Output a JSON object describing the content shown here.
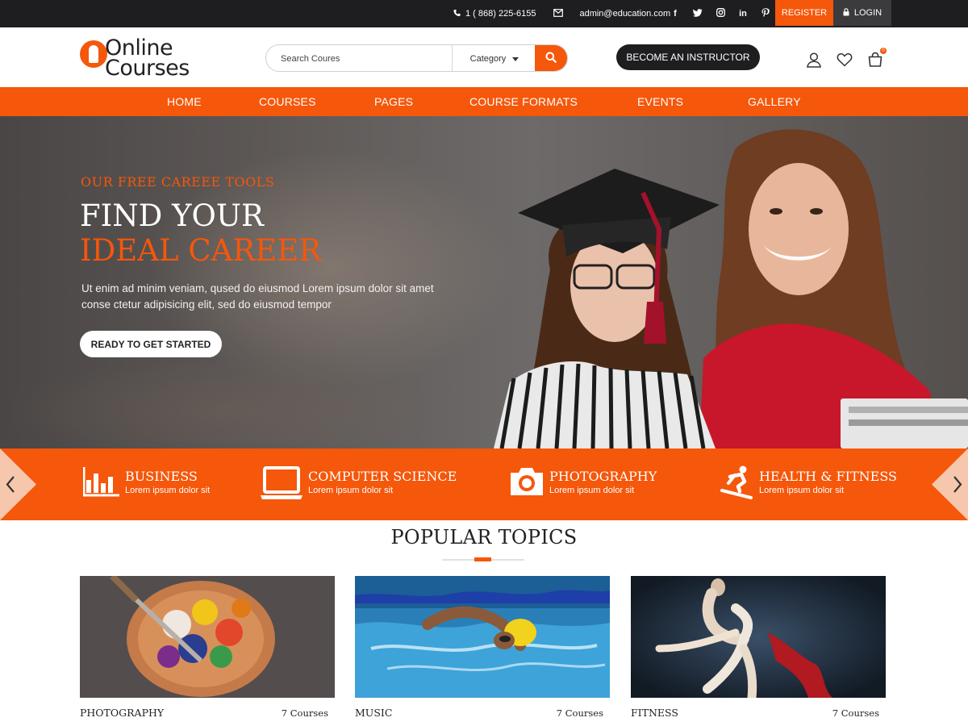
{
  "topbar": {
    "phone": "1 ( 868) 225-6155",
    "email": "admin@education.com",
    "socials": [
      "f",
      "t",
      "ig",
      "in",
      "p"
    ],
    "register_label": "REGISTER",
    "login_label": "LOGIN"
  },
  "header": {
    "logo_line1": "Online",
    "logo_line2": "Courses",
    "search_placeholder": "Search Coures",
    "category_label": "Category",
    "instructor_label": "BECOME AN INSTRUCTOR",
    "cart_count": "0"
  },
  "nav": {
    "items": [
      "HOME",
      "COURSES",
      "PAGES",
      "COURSE FORMATS",
      "EVENTS",
      "GALLERY"
    ]
  },
  "hero": {
    "eyebrow": "OUR FREE CAREEE TOOLS",
    "title_line1": "FIND YOUR",
    "title_line2": "IDEAL CAREER",
    "description": "Ut enim ad minim veniam, qused do eiusmod  Lorem ipsum dolor sit amet conse ctetur adipisicing elit, sed do eiusmod tempor",
    "cta_label": "READY TO GET STARTED"
  },
  "categories": [
    {
      "title": "BUSINESS",
      "subtitle": "Lorem ipsum dolor sit",
      "icon": "bar-chart-icon"
    },
    {
      "title": "COMPUTER SCIENCE",
      "subtitle": "Lorem ipsum dolor sit",
      "icon": "laptop-icon"
    },
    {
      "title": "PHOTOGRAPHY",
      "subtitle": "Lorem ipsum dolor sit",
      "icon": "camera-icon"
    },
    {
      "title": "HEALTH & FITNESS",
      "subtitle": "Lorem ipsum dolor sit",
      "icon": "snowboard-icon"
    }
  ],
  "popular": {
    "title": "POPULAR TOPICS",
    "cards": [
      {
        "name": "PHOTOGRAPHY",
        "count": "7 Courses"
      },
      {
        "name": "MUSIC",
        "count": "7 Courses"
      },
      {
        "name": "FITNESS",
        "count": "7 Courses"
      }
    ]
  },
  "colors": {
    "accent": "#f5570b",
    "dark": "#1e1e20"
  }
}
